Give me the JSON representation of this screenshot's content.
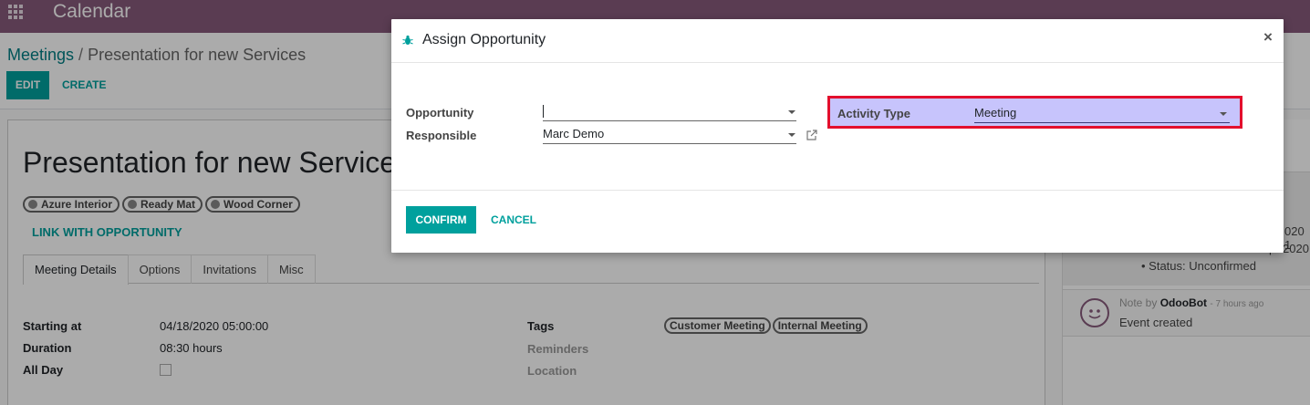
{
  "app": {
    "title": "Calendar"
  },
  "breadcrumb": {
    "parent": "Meetings",
    "separator": "/",
    "current": "Presentation for new Services"
  },
  "toolbar": {
    "edit_label": "EDIT",
    "create_label": "CREATE"
  },
  "record": {
    "title": "Presentation for new Services",
    "attendees": [
      "Azure Interior",
      "Ready Mat",
      "Wood Corner"
    ],
    "link_opportunity_label": "LINK WITH OPPORTUNITY",
    "tabs": [
      {
        "label": "Meeting Details",
        "active": true
      },
      {
        "label": "Options",
        "active": false
      },
      {
        "label": "Invitations",
        "active": false
      },
      {
        "label": "Misc",
        "active": false
      }
    ],
    "fields": {
      "starting_at_label": "Starting at",
      "starting_at_value": "04/18/2020 05:00:00",
      "duration_label": "Duration",
      "duration_value": "08:30 hours",
      "all_day_label": "All Day",
      "all_day_checked": false,
      "tags_label": "Tags",
      "tags": [
        "Customer Meeting",
        "Internal Meeting"
      ],
      "reminders_label": "Reminders",
      "location_label": "Location"
    }
  },
  "chatter": {
    "fragment_1": "020 1",
    "fragment_2": "p",
    "fragment_3": "2020",
    "status_line": "Status: Unconfirmed",
    "message": {
      "note_prefix": "Note by",
      "author": "OdooBot",
      "time": "- 7 hours ago",
      "body": "Event created"
    }
  },
  "modal": {
    "title": "Assign Opportunity",
    "close_symbol": "×",
    "opportunity_label": "Opportunity",
    "opportunity_value": "",
    "responsible_label": "Responsible",
    "responsible_value": "Marc Demo",
    "activity_type_label": "Activity Type",
    "activity_type_value": "Meeting",
    "confirm_label": "CONFIRM",
    "cancel_label": "CANCEL"
  },
  "colors": {
    "navbar": "#875a7b",
    "primary": "#00a09d",
    "highlight_fill": "#c7c4fc",
    "highlight_border": "#e30f2d"
  }
}
